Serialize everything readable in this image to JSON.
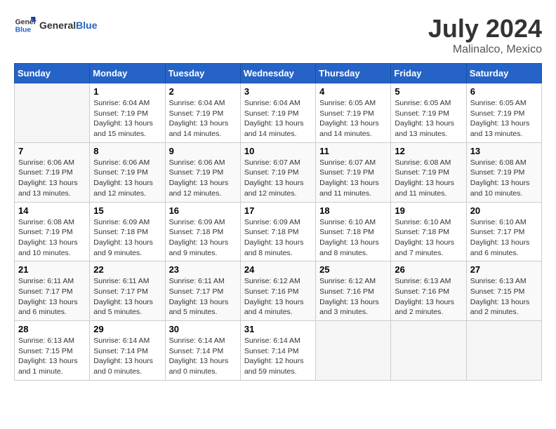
{
  "header": {
    "logo_general": "General",
    "logo_blue": "Blue",
    "month_year": "July 2024",
    "location": "Malinalco, Mexico"
  },
  "weekdays": [
    "Sunday",
    "Monday",
    "Tuesday",
    "Wednesday",
    "Thursday",
    "Friday",
    "Saturday"
  ],
  "weeks": [
    [
      {
        "day": "",
        "info": ""
      },
      {
        "day": "1",
        "info": "Sunrise: 6:04 AM\nSunset: 7:19 PM\nDaylight: 13 hours\nand 15 minutes."
      },
      {
        "day": "2",
        "info": "Sunrise: 6:04 AM\nSunset: 7:19 PM\nDaylight: 13 hours\nand 14 minutes."
      },
      {
        "day": "3",
        "info": "Sunrise: 6:04 AM\nSunset: 7:19 PM\nDaylight: 13 hours\nand 14 minutes."
      },
      {
        "day": "4",
        "info": "Sunrise: 6:05 AM\nSunset: 7:19 PM\nDaylight: 13 hours\nand 14 minutes."
      },
      {
        "day": "5",
        "info": "Sunrise: 6:05 AM\nSunset: 7:19 PM\nDaylight: 13 hours\nand 13 minutes."
      },
      {
        "day": "6",
        "info": "Sunrise: 6:05 AM\nSunset: 7:19 PM\nDaylight: 13 hours\nand 13 minutes."
      }
    ],
    [
      {
        "day": "7",
        "info": "Sunrise: 6:06 AM\nSunset: 7:19 PM\nDaylight: 13 hours\nand 13 minutes."
      },
      {
        "day": "8",
        "info": "Sunrise: 6:06 AM\nSunset: 7:19 PM\nDaylight: 13 hours\nand 12 minutes."
      },
      {
        "day": "9",
        "info": "Sunrise: 6:06 AM\nSunset: 7:19 PM\nDaylight: 13 hours\nand 12 minutes."
      },
      {
        "day": "10",
        "info": "Sunrise: 6:07 AM\nSunset: 7:19 PM\nDaylight: 13 hours\nand 12 minutes."
      },
      {
        "day": "11",
        "info": "Sunrise: 6:07 AM\nSunset: 7:19 PM\nDaylight: 13 hours\nand 11 minutes."
      },
      {
        "day": "12",
        "info": "Sunrise: 6:08 AM\nSunset: 7:19 PM\nDaylight: 13 hours\nand 11 minutes."
      },
      {
        "day": "13",
        "info": "Sunrise: 6:08 AM\nSunset: 7:19 PM\nDaylight: 13 hours\nand 10 minutes."
      }
    ],
    [
      {
        "day": "14",
        "info": "Sunrise: 6:08 AM\nSunset: 7:19 PM\nDaylight: 13 hours\nand 10 minutes."
      },
      {
        "day": "15",
        "info": "Sunrise: 6:09 AM\nSunset: 7:18 PM\nDaylight: 13 hours\nand 9 minutes."
      },
      {
        "day": "16",
        "info": "Sunrise: 6:09 AM\nSunset: 7:18 PM\nDaylight: 13 hours\nand 9 minutes."
      },
      {
        "day": "17",
        "info": "Sunrise: 6:09 AM\nSunset: 7:18 PM\nDaylight: 13 hours\nand 8 minutes."
      },
      {
        "day": "18",
        "info": "Sunrise: 6:10 AM\nSunset: 7:18 PM\nDaylight: 13 hours\nand 8 minutes."
      },
      {
        "day": "19",
        "info": "Sunrise: 6:10 AM\nSunset: 7:18 PM\nDaylight: 13 hours\nand 7 minutes."
      },
      {
        "day": "20",
        "info": "Sunrise: 6:10 AM\nSunset: 7:17 PM\nDaylight: 13 hours\nand 6 minutes."
      }
    ],
    [
      {
        "day": "21",
        "info": "Sunrise: 6:11 AM\nSunset: 7:17 PM\nDaylight: 13 hours\nand 6 minutes."
      },
      {
        "day": "22",
        "info": "Sunrise: 6:11 AM\nSunset: 7:17 PM\nDaylight: 13 hours\nand 5 minutes."
      },
      {
        "day": "23",
        "info": "Sunrise: 6:11 AM\nSunset: 7:17 PM\nDaylight: 13 hours\nand 5 minutes."
      },
      {
        "day": "24",
        "info": "Sunrise: 6:12 AM\nSunset: 7:16 PM\nDaylight: 13 hours\nand 4 minutes."
      },
      {
        "day": "25",
        "info": "Sunrise: 6:12 AM\nSunset: 7:16 PM\nDaylight: 13 hours\nand 3 minutes."
      },
      {
        "day": "26",
        "info": "Sunrise: 6:13 AM\nSunset: 7:16 PM\nDaylight: 13 hours\nand 2 minutes."
      },
      {
        "day": "27",
        "info": "Sunrise: 6:13 AM\nSunset: 7:15 PM\nDaylight: 13 hours\nand 2 minutes."
      }
    ],
    [
      {
        "day": "28",
        "info": "Sunrise: 6:13 AM\nSunset: 7:15 PM\nDaylight: 13 hours\nand 1 minute."
      },
      {
        "day": "29",
        "info": "Sunrise: 6:14 AM\nSunset: 7:14 PM\nDaylight: 13 hours\nand 0 minutes."
      },
      {
        "day": "30",
        "info": "Sunrise: 6:14 AM\nSunset: 7:14 PM\nDaylight: 13 hours\nand 0 minutes."
      },
      {
        "day": "31",
        "info": "Sunrise: 6:14 AM\nSunset: 7:14 PM\nDaylight: 12 hours\nand 59 minutes."
      },
      {
        "day": "",
        "info": ""
      },
      {
        "day": "",
        "info": ""
      },
      {
        "day": "",
        "info": ""
      }
    ]
  ]
}
